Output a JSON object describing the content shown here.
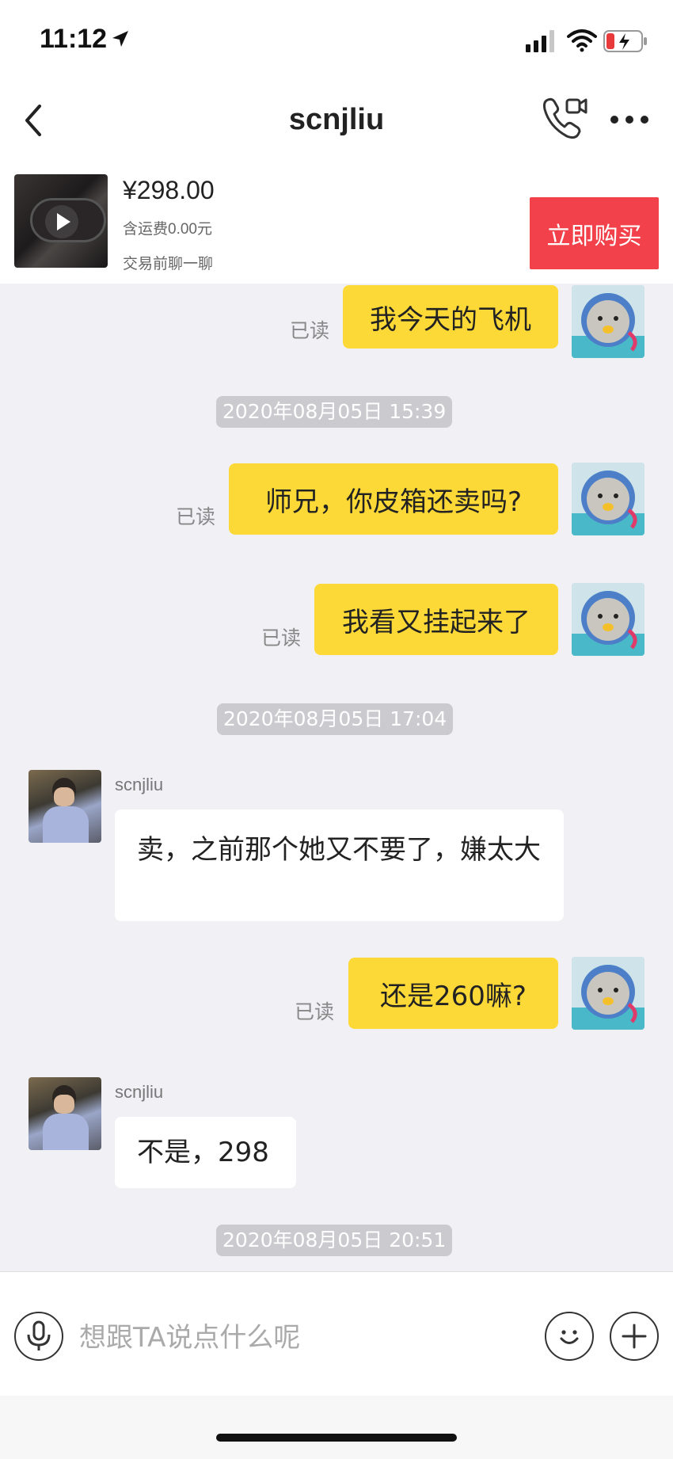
{
  "status_bar": {
    "time": "11:12"
  },
  "nav": {
    "title": "scnjliu"
  },
  "product": {
    "price": "¥298.00",
    "shipping": "含运费0.00元",
    "subtitle": "交易前聊一聊",
    "buy_label": "立即购买"
  },
  "messages": {
    "m1": {
      "text": "我今天的飞机",
      "status": "已读"
    },
    "ts1": "2020年08月05日 15:39",
    "m2": {
      "text": "师兄，你皮箱还卖吗?",
      "status": "已读"
    },
    "m3": {
      "text": "我看又挂起来了",
      "status": "已读"
    },
    "ts2": "2020年08月05日 17:04",
    "m4": {
      "sender": "scnjliu",
      "text": "卖，之前那个她又不要了，嫌太大"
    },
    "m5": {
      "text": "还是260嘛?",
      "status": "已读"
    },
    "m6": {
      "sender": "scnjliu",
      "text": "不是，298"
    },
    "ts3": "2020年08月05日 20:51"
  },
  "input": {
    "placeholder": "想跟TA说点什么呢"
  },
  "icons": {
    "back": "chevron-left-icon",
    "call": "phone-video-icon",
    "more": "more-dots-icon",
    "voice": "microphone-icon",
    "emoji": "smiley-icon",
    "add": "plus-icon",
    "play": "play-icon"
  },
  "colors": {
    "accent_yellow": "#fdd937",
    "buy_red": "#f2414a",
    "chat_bg": "#f0f0f5"
  }
}
